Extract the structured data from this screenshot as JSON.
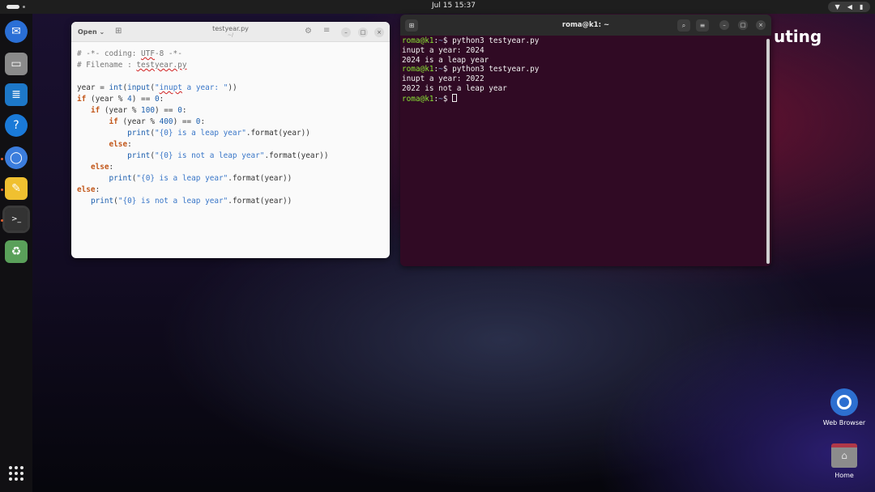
{
  "topbar": {
    "clock": "Jul 15  15:37",
    "tray_icons": [
      "wifi-icon",
      "volume-icon",
      "battery-icon"
    ]
  },
  "dock": {
    "items": [
      {
        "name": "thunderbird-icon",
        "color": "#2a6fd6"
      },
      {
        "name": "files-icon",
        "color": "#8a8a8a"
      },
      {
        "name": "writer-icon",
        "color": "#1d78c8"
      },
      {
        "name": "help-icon",
        "color": "#1a7ad8"
      },
      {
        "name": "chromium-icon",
        "color": "#3b7ddd"
      },
      {
        "name": "text-editor-icon",
        "color": "#f0c030"
      },
      {
        "name": "terminal-icon",
        "color": "#333333"
      },
      {
        "name": "trash-icon",
        "color": "#5aa05a"
      }
    ]
  },
  "editor": {
    "open_label": "Open",
    "title": "testyear.py",
    "subtitle": "~/",
    "lines": [
      "# -*- coding: UTF-8 -*-",
      "# Filename : testyear.py",
      "",
      "year = int(input(\"inupt a year: \"))",
      "if (year % 4) == 0:",
      "   if (year % 100) == 0:",
      "       if (year % 400) == 0:",
      "           print(\"{0} is a leap year\".format(year))",
      "       else:",
      "           print(\"{0} is not a leap year\".format(year))",
      "   else:",
      "       print(\"{0} is a leap year\".format(year))",
      "else:",
      "   print(\"{0} is not a leap year\".format(year))"
    ]
  },
  "terminal": {
    "title": "roma@k1: ~",
    "prompt_user": "roma@k1",
    "prompt_path": "~",
    "lines": [
      {
        "type": "cmd",
        "text": "python3 testyear.py"
      },
      {
        "type": "out",
        "text": "inupt a year: 2024"
      },
      {
        "type": "out",
        "text": "2024 is a leap year"
      },
      {
        "type": "cmd",
        "text": "python3 testyear.py"
      },
      {
        "type": "out",
        "text": "inupt a year: 2022"
      },
      {
        "type": "out",
        "text": "2022 is not a leap year"
      },
      {
        "type": "cmd",
        "text": ""
      }
    ]
  },
  "desktop": {
    "brand": "uting",
    "icons": [
      {
        "label": "Web Browser"
      },
      {
        "label": "Home"
      }
    ]
  }
}
